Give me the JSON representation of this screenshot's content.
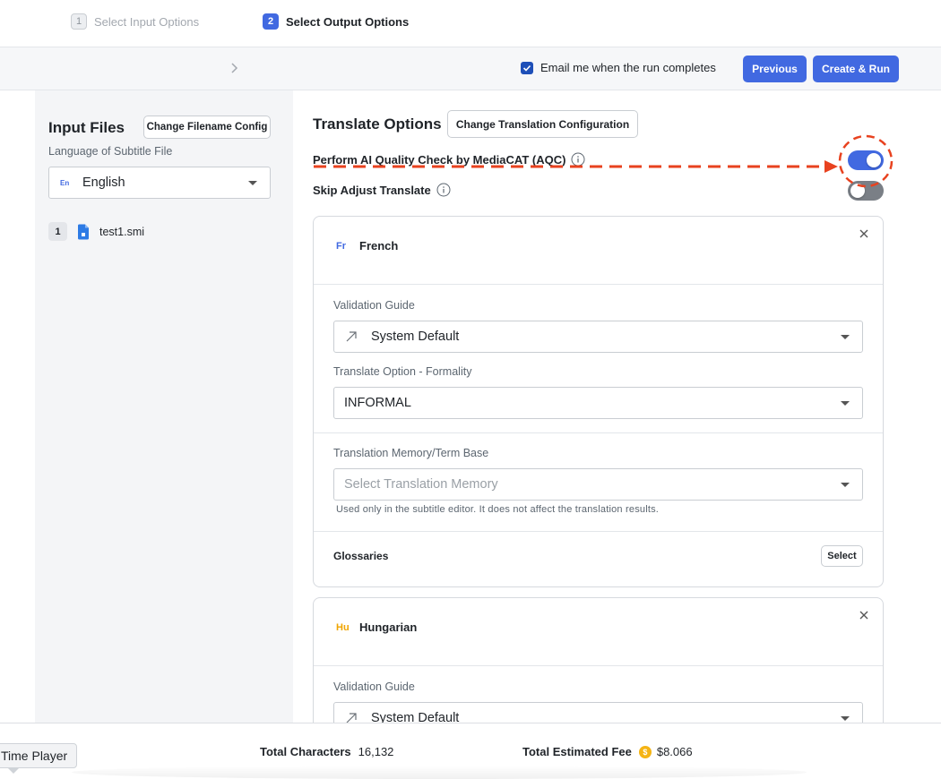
{
  "stepper": {
    "step1": {
      "num": "1",
      "label": "Select Input Options"
    },
    "step2": {
      "num": "2",
      "label": "Select Output Options"
    }
  },
  "header": {
    "email_label": "Email me when the run completes",
    "email_checked": true,
    "previous_label": "Previous",
    "create_run_label": "Create & Run"
  },
  "input_panel": {
    "title": "Input Files",
    "change_filename_label": "Change Filename Config",
    "language_label": "Language of Subtitle File",
    "language_code": "En",
    "language_value": "English",
    "files": [
      {
        "index": "1",
        "name": "test1.smi"
      }
    ]
  },
  "translate_options": {
    "title": "Translate Options",
    "change_config_label": "Change Translation Configuration",
    "aqc_label": "Perform AI Quality Check by MediaCAT (AQC)",
    "aqc_enabled": true,
    "skip_adjust_label": "Skip Adjust Translate",
    "skip_adjust_enabled": false
  },
  "languages": [
    {
      "code": "Fr",
      "name": "French",
      "validation_guide_label": "Validation Guide",
      "validation_guide_value": "System Default",
      "formality_label": "Translate Option - Formality",
      "formality_value": "INFORMAL",
      "tm_label": "Translation Memory/Term Base",
      "tm_placeholder": "Select Translation Memory",
      "tm_hint": "Used only in the subtitle editor. It does not affect the translation results.",
      "glossaries_label": "Glossaries",
      "glossaries_button": "Select"
    },
    {
      "code": "Hu",
      "name": "Hungarian",
      "validation_guide_label": "Validation Guide",
      "validation_guide_value": "System Default"
    }
  ],
  "footer": {
    "time_player_label": "Time Player",
    "total_characters_label": "Total Characters",
    "total_characters_value": "16,132",
    "total_fee_label": "Total Estimated Fee",
    "total_fee_value": "$8.066",
    "coin_symbol": "$"
  },
  "colors": {
    "accent": "#4169e1",
    "annotation": "#e8421f",
    "toggle_off": "#7a7f86"
  }
}
